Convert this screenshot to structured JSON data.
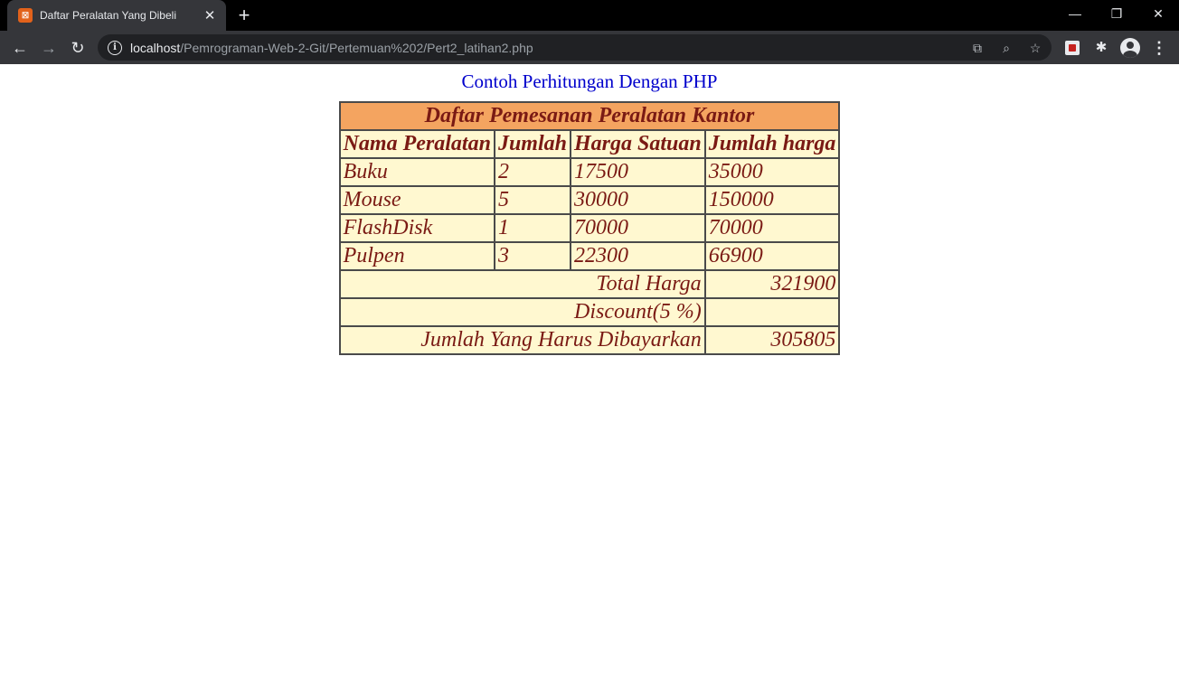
{
  "browser": {
    "tab_title": "Daftar Peralatan Yang Dibeli",
    "favicon_text": "⌖",
    "url_host": "localhost",
    "url_path": "/Pemrograman-Web-2-Git/Pertemuan%202/Pert2_latihan2.php"
  },
  "page": {
    "heading": "Contoh Perhitungan Dengan PHP",
    "table": {
      "caption": "Daftar Pemesanan Peralatan Kantor",
      "headers": [
        "Nama Peralatan",
        "Jumlah",
        "Harga Satuan",
        "Jumlah harga"
      ],
      "rows": [
        [
          "Buku",
          "2",
          "17500",
          "35000"
        ],
        [
          "Mouse",
          "5",
          "30000",
          "150000"
        ],
        [
          "FlashDisk",
          "1",
          "70000",
          "70000"
        ],
        [
          "Pulpen",
          "3",
          "22300",
          "66900"
        ]
      ],
      "total_label": "Total Harga",
      "total_value": "321900",
      "discount_label": "Discount(5 %)",
      "discount_value": "",
      "pay_label": "Jumlah Yang Harus Dibayarkan",
      "pay_value": "305805"
    }
  },
  "colors": {
    "caption_bg": "#f4a460",
    "cell_bg": "#fff8d0",
    "text": "#7a1a14",
    "heading": "#0000cc"
  }
}
